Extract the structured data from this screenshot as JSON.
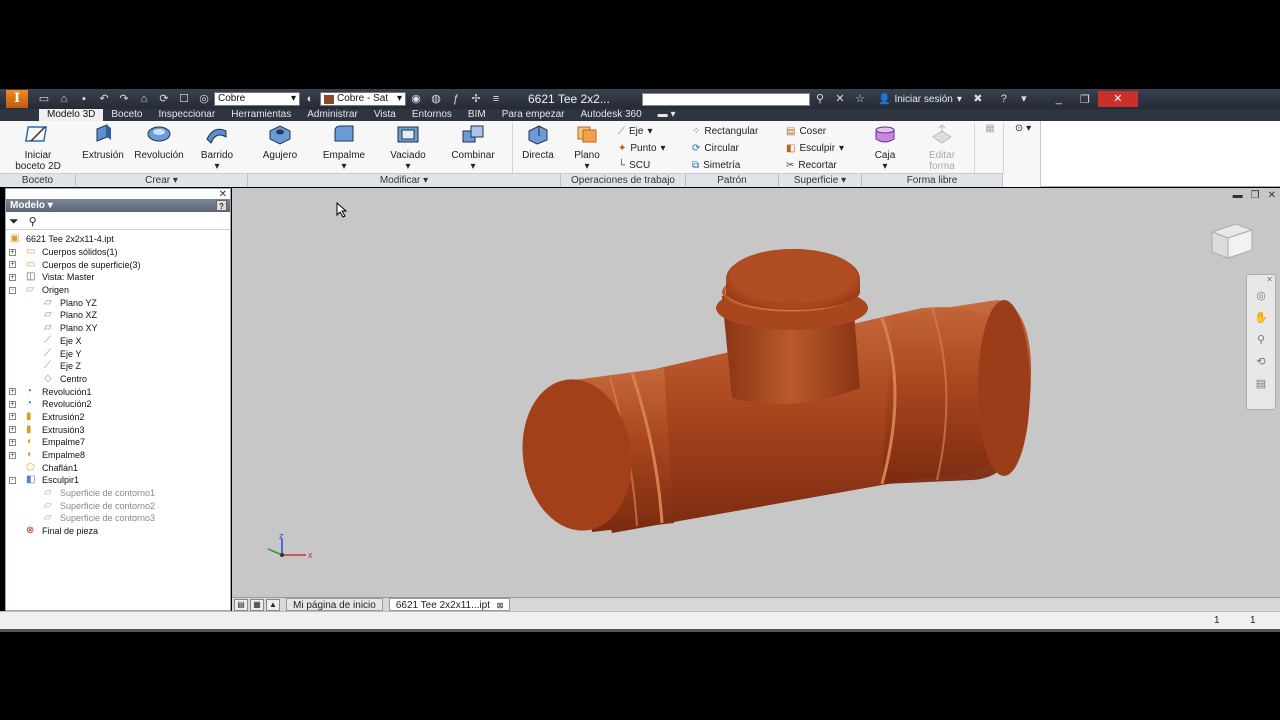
{
  "titlebar": {
    "material_value": "Cobre",
    "appearance_value": "Cobre - Sat",
    "doc_title": "6621 Tee  2x2...",
    "signin_label": "Iniciar sesión"
  },
  "ribbon_tabs": [
    "Modelo 3D",
    "Boceto",
    "Inspeccionar",
    "Herramientas",
    "Administrar",
    "Vista",
    "Entornos",
    "BIM",
    "Para empezar",
    "Autodesk 360"
  ],
  "ribbon": {
    "boceto": {
      "start_sketch_line1": "Iniciar",
      "start_sketch_line2": "boceto 2D",
      "group": "Boceto"
    },
    "crear": {
      "extrusion": "Extrusión",
      "revolucion": "Revolución",
      "barrido": "Barrido",
      "group": "Crear ▾"
    },
    "modificar": {
      "agujero": "Agujero",
      "empalme": "Empalme",
      "vaciado": "Vaciado",
      "combinar": "Combinar",
      "directa": "Directa",
      "group": "Modificar ▾"
    },
    "trabajo": {
      "plano": "Plano",
      "eje": "Eje",
      "punto": "Punto",
      "scu": "SCU",
      "group": "Operaciones de trabajo"
    },
    "patron": {
      "rectangular": "Rectangular",
      "circular": "Circular",
      "simetria": "Simetría",
      "group": "Patrón"
    },
    "superficie": {
      "coser": "Coser",
      "esculpir": "Esculpir",
      "recortar": "Recortar",
      "group": "Superficie ▾"
    },
    "forma_libre": {
      "caja": "Caja",
      "editar_line1": "Editar",
      "editar_line2": "forma",
      "group": "Forma libre"
    }
  },
  "browser": {
    "title": "Modelo ▾",
    "tree": [
      {
        "label": "6621 Tee  2x2x11-4.ipt",
        "indent": 0,
        "exp": "",
        "icon": "part-icon",
        "grey": false
      },
      {
        "label": "Cuerpos sólidos(1)",
        "indent": 1,
        "exp": "+",
        "icon": "folder-icon",
        "grey": false
      },
      {
        "label": "Cuerpos de superficie(3)",
        "indent": 1,
        "exp": "+",
        "icon": "folder-icon",
        "grey": false
      },
      {
        "label": "Vista: Master",
        "indent": 1,
        "exp": "+",
        "icon": "view-icon",
        "grey": false
      },
      {
        "label": "Origen",
        "indent": 1,
        "exp": "-",
        "icon": "folder-open-icon",
        "grey": false
      },
      {
        "label": "Plano YZ",
        "indent": 2,
        "exp": "",
        "icon": "plane-icon",
        "grey": false
      },
      {
        "label": "Plano XZ",
        "indent": 2,
        "exp": "",
        "icon": "plane-icon",
        "grey": false
      },
      {
        "label": "Plano XY",
        "indent": 2,
        "exp": "",
        "icon": "plane-icon",
        "grey": false
      },
      {
        "label": "Eje X",
        "indent": 2,
        "exp": "",
        "icon": "axis-icon",
        "grey": false
      },
      {
        "label": "Eje Y",
        "indent": 2,
        "exp": "",
        "icon": "axis-icon",
        "grey": false
      },
      {
        "label": "Eje Z",
        "indent": 2,
        "exp": "",
        "icon": "axis-icon",
        "grey": false
      },
      {
        "label": "Centro",
        "indent": 2,
        "exp": "",
        "icon": "point-icon",
        "grey": false
      },
      {
        "label": "Revolución1",
        "indent": 1,
        "exp": "+",
        "icon": "revolve-icon",
        "grey": false
      },
      {
        "label": "Revolución2",
        "indent": 1,
        "exp": "+",
        "icon": "revolve-icon",
        "grey": false
      },
      {
        "label": "Extrusión2",
        "indent": 1,
        "exp": "+",
        "icon": "extrude-icon",
        "grey": false
      },
      {
        "label": "Extrusión3",
        "indent": 1,
        "exp": "+",
        "icon": "extrude-icon",
        "grey": false
      },
      {
        "label": "Empalme7",
        "indent": 1,
        "exp": "+",
        "icon": "fillet-icon",
        "grey": false
      },
      {
        "label": "Empalme8",
        "indent": 1,
        "exp": "+",
        "icon": "fillet-icon",
        "grey": false
      },
      {
        "label": "Chaflán1",
        "indent": 1,
        "exp": "",
        "icon": "chamfer-icon",
        "grey": false
      },
      {
        "label": "Esculpir1",
        "indent": 1,
        "exp": "-",
        "icon": "sculpt-icon",
        "grey": false
      },
      {
        "label": "Superficie de contorno1",
        "indent": 2,
        "exp": "",
        "icon": "surface-icon",
        "grey": true
      },
      {
        "label": "Superficie de contorno2",
        "indent": 2,
        "exp": "",
        "icon": "surface-icon",
        "grey": true
      },
      {
        "label": "Superficie de contorno3",
        "indent": 2,
        "exp": "",
        "icon": "surface-icon",
        "grey": true
      },
      {
        "label": "Final de pieza",
        "indent": 1,
        "exp": "",
        "icon": "end-of-part-icon",
        "grey": false
      }
    ]
  },
  "doctabs": {
    "home": "Mi página de inicio",
    "part": "6621 Tee  2x2x11...ipt"
  },
  "status": {
    "n1": "1",
    "n2": "1"
  },
  "triad": {
    "x": "x",
    "z": "z"
  },
  "colors": {
    "copper": "#a8441e",
    "copper_light": "#c96a3a",
    "viewport": "#c7c7c7",
    "titlebar": "#2e3440"
  }
}
